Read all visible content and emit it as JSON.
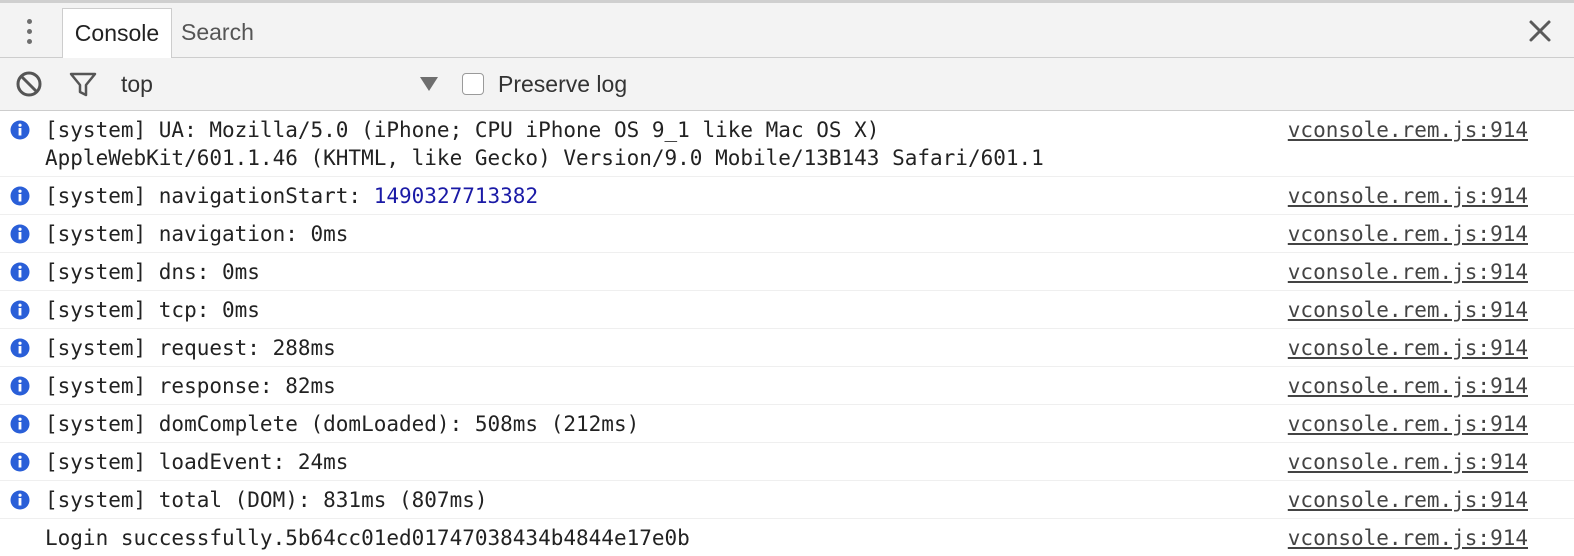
{
  "tabs": {
    "console": "Console",
    "search": "Search"
  },
  "toolbar": {
    "context": "top",
    "preserve_log": "Preserve log"
  },
  "messages": [
    {
      "level": "info",
      "text": "[system] UA: Mozilla/5.0 (iPhone; CPU iPhone OS 9_1 like Mac OS X)\nAppleWebKit/601.1.46 (KHTML, like Gecko) Version/9.0 Mobile/13B143 Safari/601.1",
      "source": "vconsole.rem.js:914"
    },
    {
      "level": "info",
      "prefix": "[system] navigationStart: ",
      "number": "1490327713382",
      "source": "vconsole.rem.js:914"
    },
    {
      "level": "info",
      "text": "[system] navigation: 0ms",
      "source": "vconsole.rem.js:914"
    },
    {
      "level": "info",
      "text": "[system] dns: 0ms",
      "source": "vconsole.rem.js:914"
    },
    {
      "level": "info",
      "text": "[system] tcp: 0ms",
      "source": "vconsole.rem.js:914"
    },
    {
      "level": "info",
      "text": "[system] request: 288ms",
      "source": "vconsole.rem.js:914"
    },
    {
      "level": "info",
      "text": "[system] response: 82ms",
      "source": "vconsole.rem.js:914"
    },
    {
      "level": "info",
      "text": "[system] domComplete (domLoaded): 508ms (212ms)",
      "source": "vconsole.rem.js:914"
    },
    {
      "level": "info",
      "text": "[system] loadEvent: 24ms",
      "source": "vconsole.rem.js:914"
    },
    {
      "level": "info",
      "text": "[system] total (DOM): 831ms (807ms)",
      "source": "vconsole.rem.js:914"
    },
    {
      "level": "log",
      "text": "Login successfully.5b64cc01ed01747038434b4844e17e0b",
      "source": "vconsole.rem.js:914"
    }
  ],
  "colors": {
    "info_icon": "#2a5fd8",
    "number": "#1a1aa6",
    "toolbar_bg": "#f3f3f3"
  },
  "icons": {
    "menu": "kebab-menu-icon",
    "close": "close-icon",
    "clear": "clear-console-icon",
    "filter": "filter-icon",
    "dropdown": "dropdown-arrow-icon",
    "info": "info-icon"
  }
}
